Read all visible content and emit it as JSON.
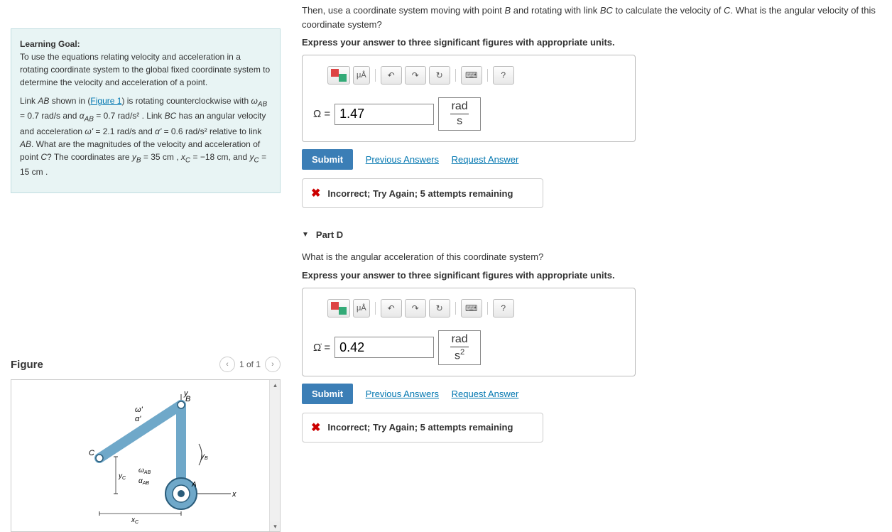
{
  "goal": {
    "heading": "Learning Goal:",
    "p1": "To use the equations relating velocity and acceleration in a rotating coordinate system to the global fixed coordinate system to determine the velocity and acceleration of a point.",
    "p2_pre": "Link AB shown in (",
    "p2_link": "Figure 1",
    "p2_post": ") is rotating counterclockwise with ω_AB = 0.7 rad/s and α_AB = 0.7 rad/s² . Link BC has an angular velocity and acceleration ω' = 2.1 rad/s and α' = 0.6 rad/s² relative to link AB. What are the magnitudes of the velocity and acceleration of point C? The coordinates are y_B = 35 cm , x_C = −18 cm, and y_C = 15 cm ."
  },
  "figure": {
    "title": "Figure",
    "nav": "1 of 1"
  },
  "partC": {
    "prompt": "Then, use a coordinate system moving with point B and rotating with link BC to calculate the velocity of C. What is the angular velocity of this coordinate system?",
    "instruct": "Express your answer to three significant figures with appropriate units.",
    "label": "Ω =",
    "value": "1.47",
    "unit_num": "rad",
    "unit_den": "s",
    "submit": "Submit",
    "prev": "Previous Answers",
    "req": "Request Answer",
    "feedback": "Incorrect; Try Again; 5 attempts remaining"
  },
  "partD": {
    "header": "Part D",
    "prompt": "What is the angular acceleration of this coordinate system?",
    "instruct": "Express your answer to three significant figures with appropriate units.",
    "label": "Ω̇ =",
    "value": "0.42",
    "unit_num": "rad",
    "unit_den": "s²",
    "submit": "Submit",
    "prev": "Previous Answers",
    "req": "Request Answer",
    "feedback": "Incorrect; Try Again; 5 attempts remaining"
  },
  "toolbar": {
    "mua": "μÅ",
    "help": "?",
    "kbd": "⌨"
  }
}
